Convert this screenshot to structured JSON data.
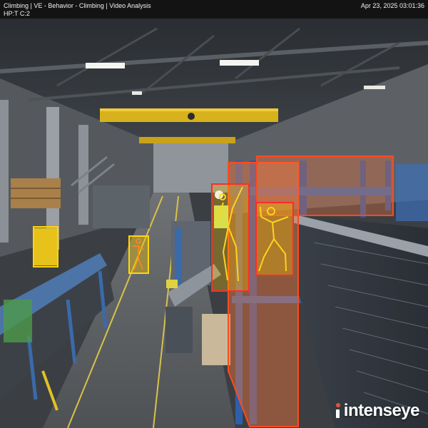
{
  "header": {
    "title": "Climbing | VE - Behavior - Climbing | Video Analysis",
    "subtitle": "HP:T C:2",
    "timestamp": "Apr 23, 2025 03:01:36"
  },
  "branding": {
    "logo_text": "intenseye"
  },
  "colors": {
    "header_bg": "#121212",
    "violation_outline": "#ff4a1f",
    "violation_fill": "#ff7a3a",
    "person_outline": "#ffd60a",
    "person_fill": "#f2c200",
    "skeleton": "#ffd21f",
    "person_alert_outline": "#ff2b2b",
    "logo_accent": "#e8503a"
  }
}
